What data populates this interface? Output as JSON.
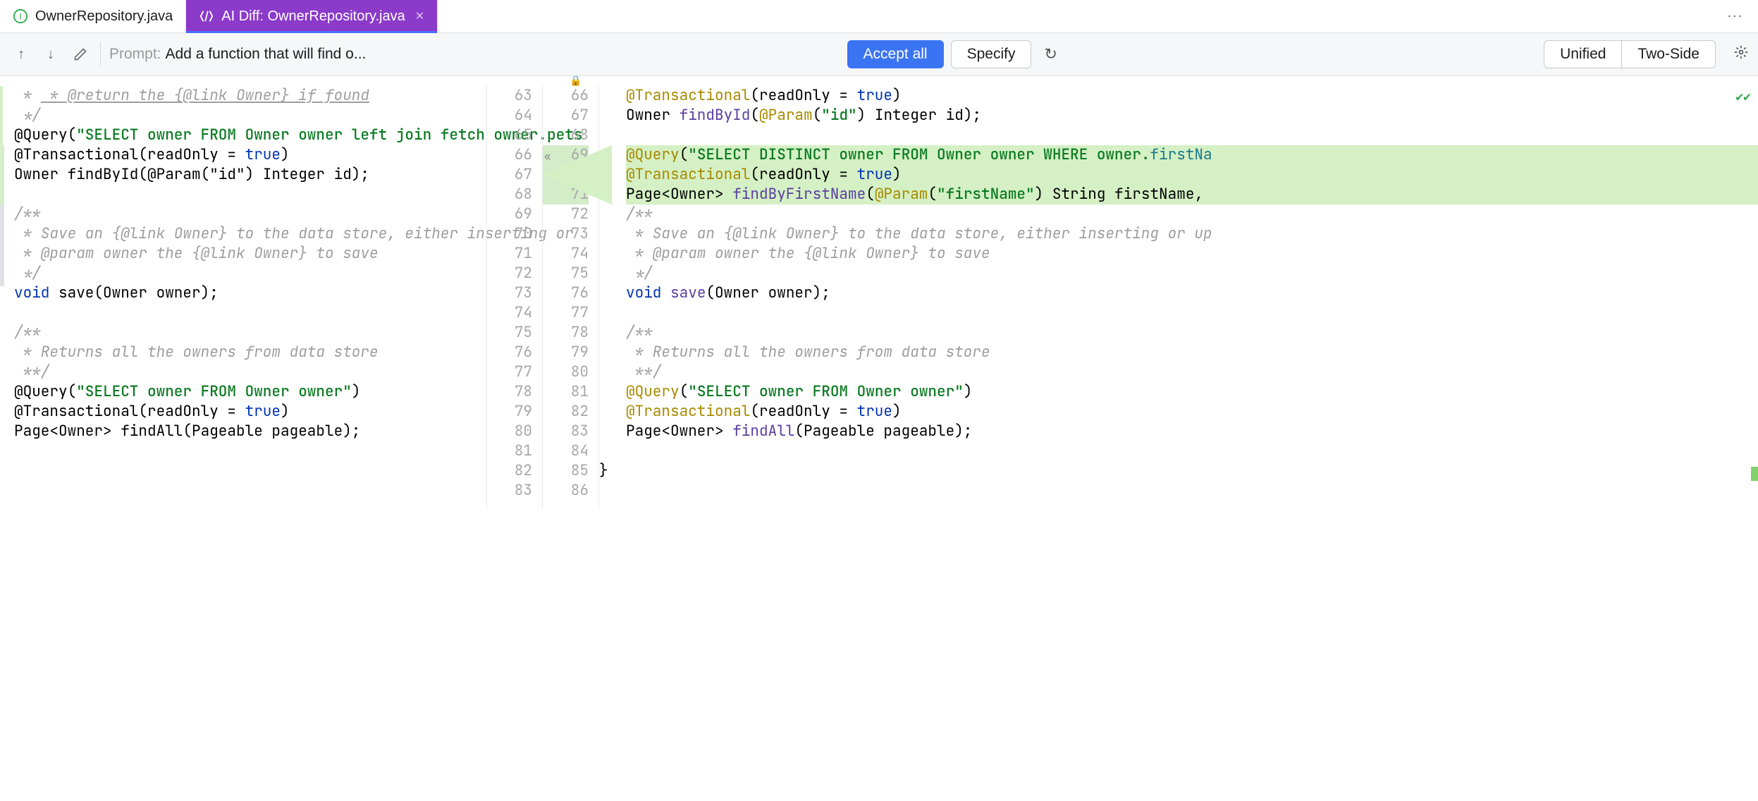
{
  "tabs": [
    {
      "label": "OwnerRepository.java",
      "icon": "java-interface-icon",
      "active": false
    },
    {
      "label": "AI Diff: OwnerRepository.java",
      "icon": "ai-diff-icon",
      "active": true
    }
  ],
  "toolbar": {
    "prompt_label": "Prompt:",
    "prompt_text": "Add a function that will find o...",
    "accept_all": "Accept all",
    "specify": "Specify",
    "view_unified": "Unified",
    "view_two_side": "Two-Side"
  },
  "gutters": {
    "left": [
      "63",
      "64",
      "65",
      "66",
      "67",
      "68",
      "69",
      "70",
      "71",
      "72",
      "73",
      "74",
      "75",
      "76",
      "77",
      "78",
      "79",
      "80",
      "81",
      "82",
      "83"
    ],
    "right": [
      "66",
      "67",
      "68",
      "69",
      "70",
      "71",
      "72",
      "73",
      "74",
      "75",
      "76",
      "77",
      "78",
      "79",
      "80",
      "81",
      "82",
      "83",
      "84",
      "85",
      "86"
    ],
    "right_inserted": [
      "69",
      "70",
      "71"
    ]
  },
  "left_code": {
    "l63": " * @return the {@link Owner} if found",
    "l64": " */",
    "l65": {
      "pre": "@Query(",
      "str": "\"SELECT owner FROM Owner owner left join fetch owner.pets",
      "post": ""
    },
    "l66": {
      "ann": "@Transactional",
      "rest": "(readOnly = ",
      "val": "true",
      "end": ")"
    },
    "l67": "Owner findById(@Param(\"id\") Integer id);",
    "l69": "/**",
    "l70": " * Save an {@link Owner} to the data store, either inserting or ",
    "l71": " * @param owner the {@link Owner} to save",
    "l72": " */",
    "l73": {
      "kw": "void",
      "rest": " save(Owner owner);"
    },
    "l75": "/**",
    "l76": " * Returns all the owners from data store",
    "l77": " **/",
    "l78": {
      "pre": "@Query(",
      "str": "\"SELECT owner FROM Owner owner\"",
      "post": ")"
    },
    "l79": {
      "ann": "@Transactional",
      "rest": "(readOnly = ",
      "val": "true",
      "end": ")"
    },
    "l80": "Page<Owner> findAll(Pageable pageable);",
    "l82": "}"
  },
  "right_code": {
    "r66": {
      "ann": "@Transactional",
      "rest": "(readOnly = ",
      "val": "true",
      "end": ")"
    },
    "r67": {
      "pre": "Owner ",
      "fn": "findById",
      "mid": "(",
      "ann2": "@Param",
      "paren": "(",
      "str": "\"id\"",
      "rest": ") Integer id);"
    },
    "r69": {
      "pre": "@Query(",
      "str": "\"SELECT DISTINCT owner FROM Owner owner WHERE owner.",
      "tail": "firstNa"
    },
    "r70": {
      "ann": "@Transactional",
      "rest": "(readOnly = ",
      "val": "true",
      "end": ")"
    },
    "r71": {
      "pre": "Page<Owner> ",
      "fn": "findByFirstName",
      "mid": "(",
      "ann2": "@Param",
      "paren": "(",
      "str": "\"firstName\"",
      "rest": ") String firstName, "
    },
    "r72": "/**",
    "r73": " * Save an {@link Owner} to the data store, either inserting or up",
    "r74": " * @param owner the {@link Owner} to save",
    "r75": " */",
    "r76": {
      "kw": "void",
      "rest": " ",
      "fn": "save",
      "post": "(Owner owner);"
    },
    "r78": "/**",
    "r79": " * Returns all the owners from data store",
    "r80": " **/",
    "r81": {
      "pre": "@Query(",
      "str": "\"SELECT owner FROM Owner owner\"",
      "post": ")"
    },
    "r82": {
      "ann": "@Transactional",
      "rest": "(readOnly = ",
      "val": "true",
      "end": ")"
    },
    "r83": {
      "pre": "Page<Owner> ",
      "fn": "findAll",
      "post": "(Pageable pageable);"
    },
    "r85": "}"
  }
}
